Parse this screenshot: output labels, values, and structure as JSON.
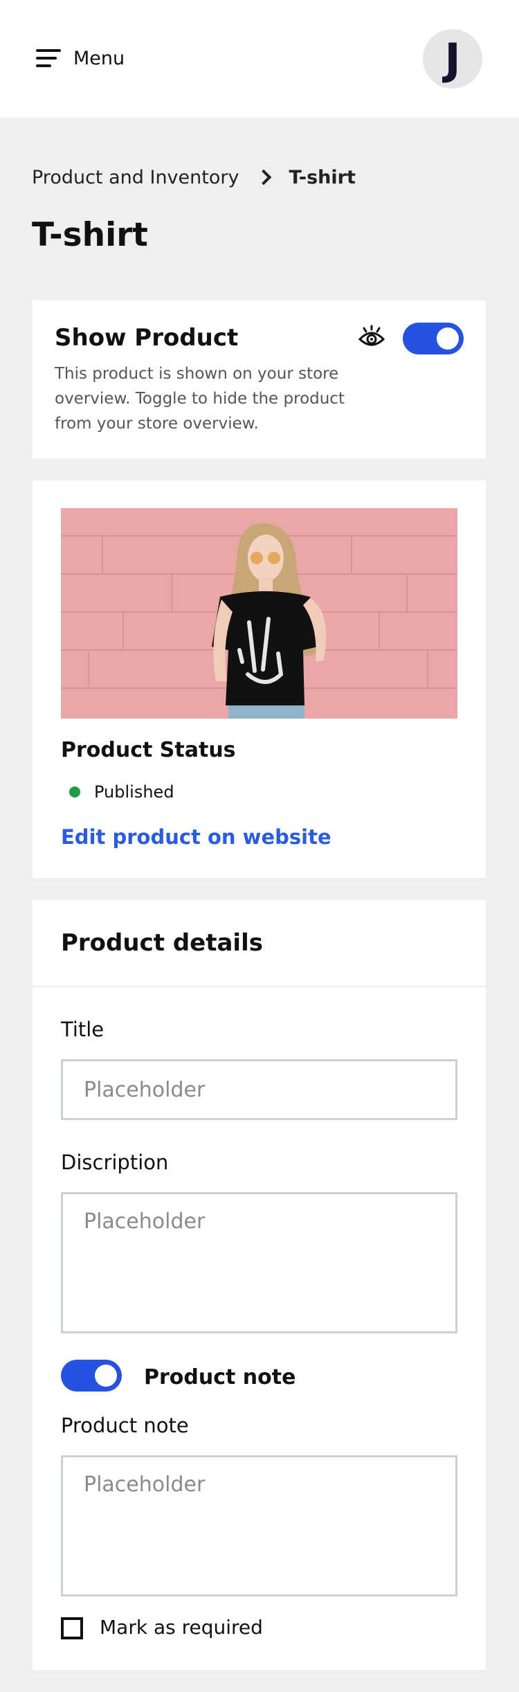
{
  "header": {
    "menu_label": "Menu",
    "avatar_initial": "J"
  },
  "breadcrumb": {
    "parent": "Product and Inventory",
    "current": "T-shirt"
  },
  "page_title": "T-shirt",
  "visibility": {
    "title": "Show Product",
    "description": "This product is shown on your store overview. Toggle to hide the product from your store overview.",
    "toggle_on": true
  },
  "status_card": {
    "image_icon": "product-photo",
    "status_title": "Product Status",
    "status_value": "Published",
    "status_color": "#1e9a4a",
    "edit_link": "Edit product on website"
  },
  "details": {
    "heading": "Product details",
    "title_label": "Title",
    "title_placeholder": "Placeholder",
    "description_label": "Discription",
    "description_placeholder": "Placeholder",
    "note_toggle_label": "Product note",
    "note_toggle_on": true,
    "note_label": "Product note",
    "note_placeholder": "Placeholder",
    "required_label": "Mark as required",
    "required_checked": false
  },
  "colors": {
    "accent": "#2553e0",
    "link": "#2a5ce0",
    "background": "#efefef"
  }
}
